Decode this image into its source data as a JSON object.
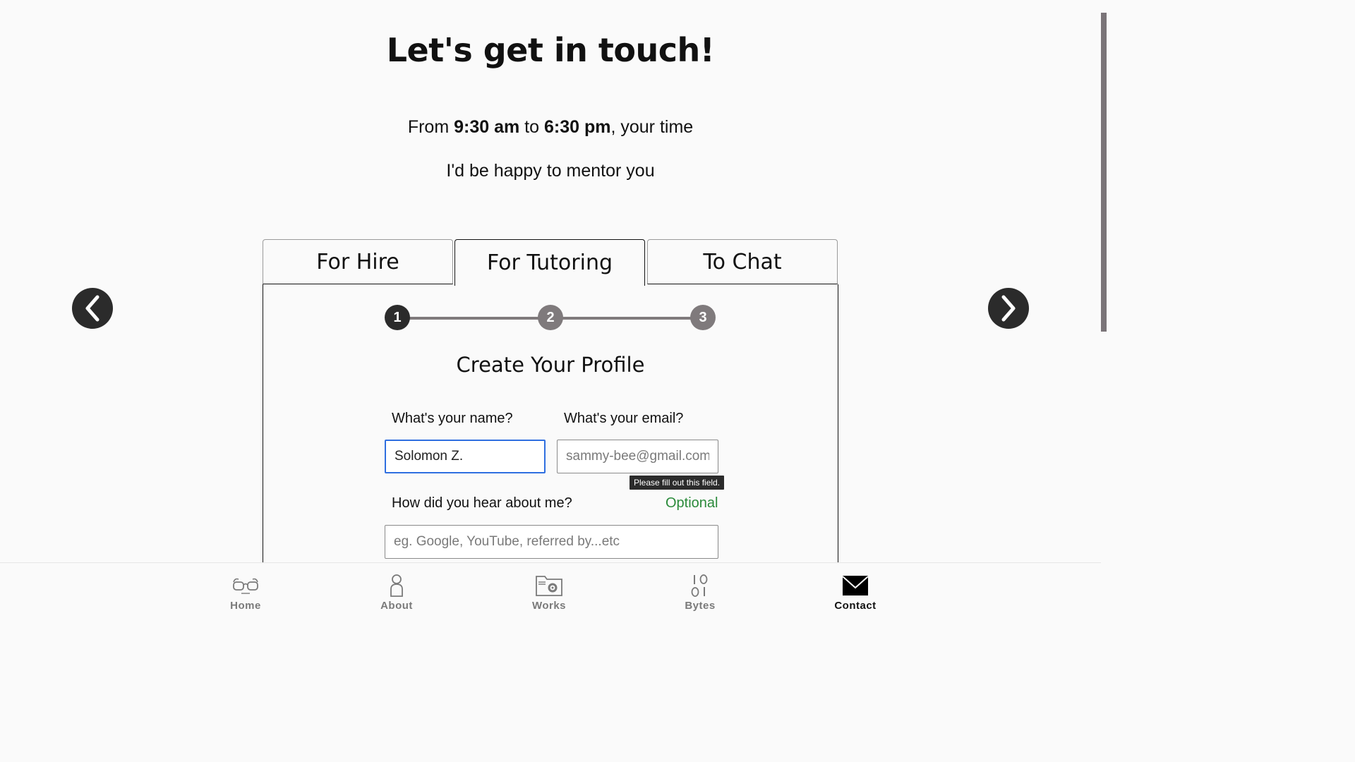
{
  "header": {
    "title": "Let's get in touch!",
    "hours_prefix": "From ",
    "hours_start": "9:30 am",
    "hours_mid": " to ",
    "hours_end": "6:30 pm",
    "hours_suffix": ", your time",
    "mentor_text": "I'd be happy to mentor you"
  },
  "tabs": [
    {
      "label": "For Hire"
    },
    {
      "label": "For Tutoring",
      "active": true
    },
    {
      "label": "To Chat"
    }
  ],
  "stepper": {
    "steps": [
      "1",
      "2",
      "3"
    ],
    "current": 1
  },
  "form": {
    "title": "Create Your Profile",
    "name_label": "What's your name?",
    "name_value": "Solomon Z.",
    "email_label": "What's your email?",
    "email_placeholder": "sammy-bee@gmail.com",
    "validation_tooltip": "Please fill out this field.",
    "hear_label": "How did you hear about me?",
    "optional_label": "Optional",
    "hear_placeholder": "eg. Google, YouTube, referred by...etc"
  },
  "carousel": {
    "prev_icon": "chevron-left-icon",
    "next_icon": "chevron-right-icon"
  },
  "bottom_nav": [
    {
      "label": "Home",
      "icon": "glasses-icon"
    },
    {
      "label": "About",
      "icon": "person-icon"
    },
    {
      "label": "Works",
      "icon": "folder-gear-icon"
    },
    {
      "label": "Bytes",
      "icon": "binary-icon"
    },
    {
      "label": "Contact",
      "icon": "envelope-icon",
      "active": true
    }
  ],
  "colors": {
    "accent_focus": "#2f6fe0",
    "optional_green": "#2a8a3a",
    "dark": "#2b2b2b",
    "step_inactive": "#7f7a7c"
  }
}
